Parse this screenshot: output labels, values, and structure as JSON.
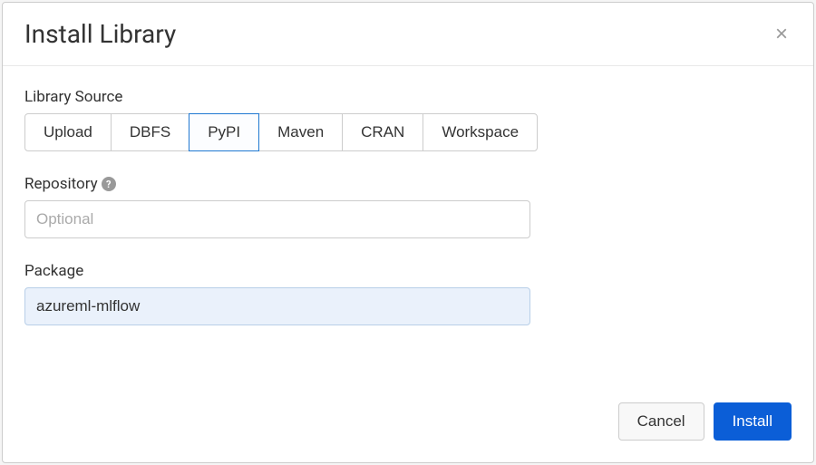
{
  "dialog": {
    "title": "Install Library",
    "close_symbol": "×"
  },
  "library_source": {
    "label": "Library Source",
    "options": [
      "Upload",
      "DBFS",
      "PyPI",
      "Maven",
      "CRAN",
      "Workspace"
    ],
    "selected": "PyPI"
  },
  "repository": {
    "label": "Repository",
    "placeholder": "Optional",
    "value": "",
    "help_symbol": "?"
  },
  "package": {
    "label": "Package",
    "value": "azureml-mlflow"
  },
  "footer": {
    "cancel_label": "Cancel",
    "install_label": "Install"
  }
}
